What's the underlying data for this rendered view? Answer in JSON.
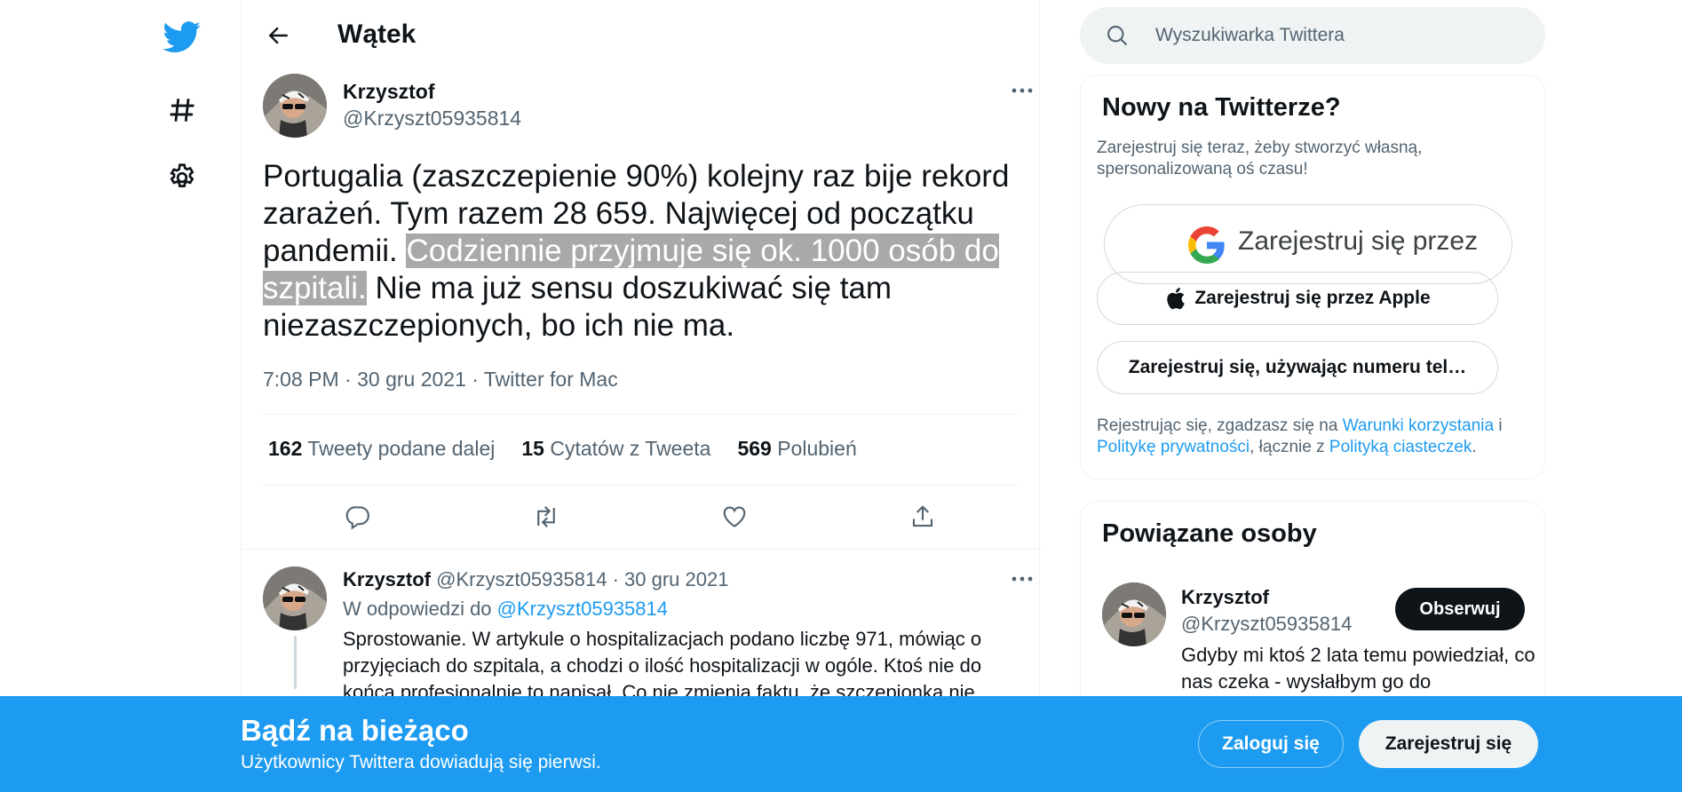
{
  "colors": {
    "accent": "#1d9bf0",
    "text": "#0f1419",
    "muted": "#536471",
    "highlight": "#a9a9a9"
  },
  "nav": {
    "items": [
      {
        "icon": "twitter-logo-icon"
      },
      {
        "icon": "hashtag-icon"
      },
      {
        "icon": "gear-icon"
      }
    ]
  },
  "header": {
    "title": "Wątek"
  },
  "tweet": {
    "author_name": "Krzysztof",
    "author_handle": "@Krzyszt05935814",
    "text_before": "Portugalia (zaszczepienie 90%) kolejny raz bije rekord zarażeń. Tym razem 28 659. Najwięcej od początku pandemii. ",
    "text_highlight": "Codziennie przyjmuje się ok. 1000 osób do szpitali.",
    "text_after": " Nie ma już sensu doszukiwać się tam niezaszczepionych, bo ich nie ma.",
    "meta": "7:08 PM · 30 gru 2021 · Twitter for Mac",
    "stats": [
      {
        "count": "162",
        "label": "Tweety podane dalej"
      },
      {
        "count": "15",
        "label": "Cytatów z Tweeta"
      },
      {
        "count": "569",
        "label": "Polubień"
      }
    ]
  },
  "reply": {
    "author_name": "Krzysztof",
    "author_handle": "@Krzyszt05935814",
    "date": "30 gru 2021",
    "reply_prefix": "W odpowiedzi do",
    "reply_to": "@Krzyszt05935814",
    "text": "Sprostowanie. W artykule o hospitalizacjach podano liczbę 971, mówiąc o przyjęciach do szpitala, a chodzi o ilość hospitalizacji w ogóle. Ktoś nie do końca profesjonalnie to napisał. Co nie zmienia faktu, że szczepionka nie"
  },
  "sidebar": {
    "search_placeholder": "Wyszukiwarka Twittera",
    "signup_card": {
      "title": "Nowy na Twitterze?",
      "subtitle": "Zarejestruj się teraz, żeby stworzyć własną, spersonalizowaną oś czasu!",
      "google_label": "Zarejestruj się przez",
      "apple_label": "Zarejestruj się przez Apple",
      "phone_label": "Zarejestruj się, używając numeru tel…",
      "terms_prefix": "Rejestrując się, zgadzasz się na",
      "terms_link": "Warunki korzystania",
      "terms_and": "i",
      "privacy_link": "Politykę prywatności",
      "terms_mid": ", łącznie z",
      "cookies_link": "Polityką ciasteczek",
      "terms_end": "."
    },
    "related": {
      "title": "Powiązane osoby",
      "name": "Krzysztof",
      "handle": "@Krzyszt05935814",
      "follow_label": "Obserwuj",
      "bio": "Gdyby mi ktoś 2 lata temu powiedział, co nas czeka - wysłałbym go do"
    }
  },
  "banner": {
    "title": "Bądź na bieżąco",
    "subtitle": "Użytkownicy Twittera dowiadują się pierwsi.",
    "login_label": "Zaloguj się",
    "signup_label": "Zarejestruj się"
  }
}
